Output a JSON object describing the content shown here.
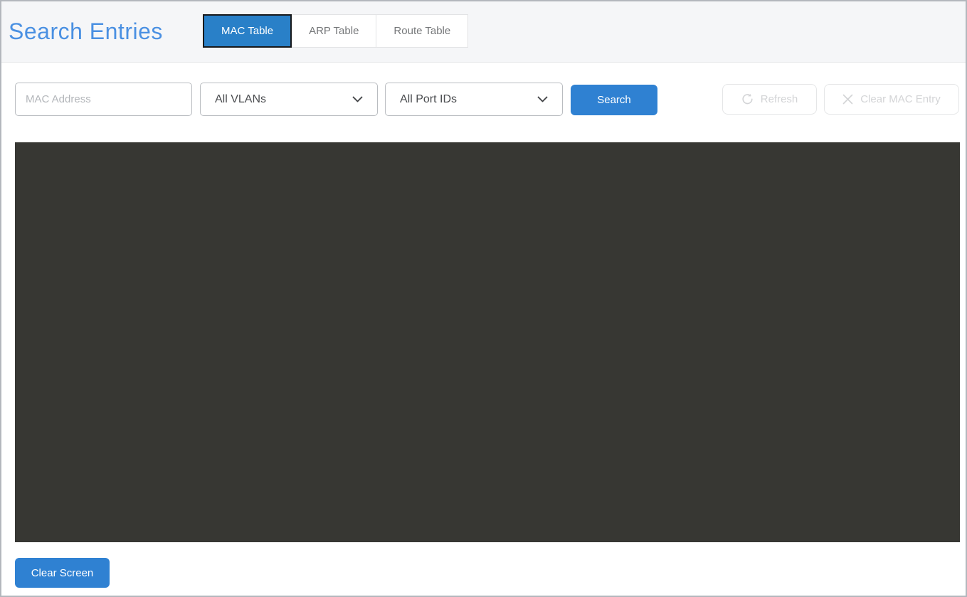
{
  "page": {
    "title": "Search Entries"
  },
  "tabs": [
    {
      "label": "MAC Table",
      "active": true
    },
    {
      "label": "ARP Table",
      "active": false
    },
    {
      "label": "Route Table",
      "active": false
    }
  ],
  "filters": {
    "mac_address_placeholder": "MAC Address",
    "vlan_selected": "All VLANs",
    "port_selected": "All Port IDs",
    "search_label": "Search"
  },
  "actions": {
    "refresh_label": "Refresh",
    "clear_mac_label": "Clear MAC Entry"
  },
  "console": {
    "content": "",
    "clear_screen_label": "Clear Screen"
  },
  "icons": {
    "vlan_dropdown": "chevron-down-icon",
    "port_dropdown": "chevron-down-icon",
    "refresh": "refresh-icon",
    "clear_mac": "close-icon"
  },
  "colors": {
    "title_blue": "#4a90e2",
    "active_tab_blue": "#2980c8",
    "button_blue": "#2f81d2",
    "console_background": "#373733",
    "header_background": "#f5f6f8",
    "disabled_text": "#d3d4d6"
  }
}
